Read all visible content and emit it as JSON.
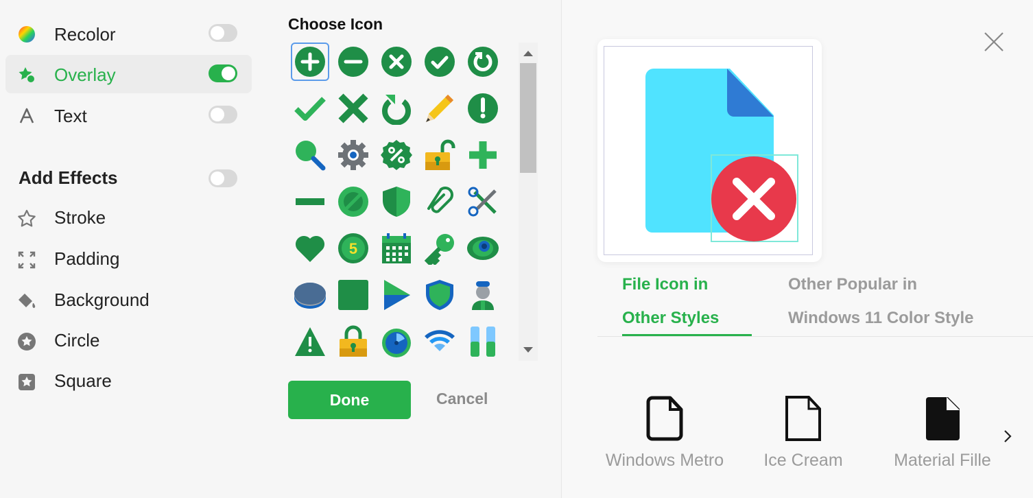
{
  "overlay_options": [
    {
      "label": "Recolor",
      "icon": "color-wheel-icon",
      "on": false
    },
    {
      "label": "Overlay",
      "icon": "overlay-star-icon",
      "on": true
    },
    {
      "label": "Text",
      "icon": "text-a-icon",
      "on": false
    }
  ],
  "effects": {
    "title": "Add Effects",
    "toggle_on": false,
    "items": [
      {
        "label": "Stroke",
        "icon": "star-outline-icon"
      },
      {
        "label": "Padding",
        "icon": "padding-arrows-icon"
      },
      {
        "label": "Background",
        "icon": "paint-bucket-icon"
      },
      {
        "label": "Circle",
        "icon": "circle-star-icon"
      },
      {
        "label": "Square",
        "icon": "square-star-icon"
      }
    ]
  },
  "chooser": {
    "title": "Choose Icon",
    "icons": [
      "add-circle-icon",
      "minus-circle-icon",
      "close-circle-icon",
      "check-circle-icon",
      "refresh-circle-icon",
      "checkmark-icon",
      "x-mark-icon",
      "rotate-arrow-icon",
      "pencil-icon",
      "exclamation-circle-icon",
      "magnifier-icon",
      "settings-gear-icon",
      "percent-badge-icon",
      "unlocked-padlock-icon",
      "plus-icon",
      "minus-bar-icon",
      "cancel-circle-icon",
      "shield-icon",
      "paperclip-icon",
      "scissors-icon",
      "heart-icon",
      "number-5-icon",
      "calendar-icon",
      "key-icon",
      "eye-icon",
      "disc-icon",
      "square-icon",
      "play-triangle-icon",
      "shield-check-icon",
      "user-icon",
      "warning-triangle-icon",
      "locked-padlock-icon",
      "stopwatch-icon",
      "wifi-icon",
      "pause-icon"
    ],
    "selected_index": 0,
    "done_label": "Done",
    "cancel_label": "Cancel"
  },
  "preview": {
    "base_icon": "file-icon",
    "overlay_icon": "close-circle-icon",
    "colors": {
      "file": "#50e3ff",
      "corner": "#2f7bd4",
      "overlay": "#e8394b",
      "accent": "#28b14c"
    }
  },
  "tabs": [
    {
      "line1": "File Icon in",
      "line2": "Other Styles",
      "active": true
    },
    {
      "line1": "Other Popular in",
      "line2": "Windows 11 Color Style",
      "active": false
    }
  ],
  "styles": [
    {
      "label": "Windows Metro",
      "icon": "file-rounded-outline-icon"
    },
    {
      "label": "Ice Cream",
      "icon": "file-outline-icon"
    },
    {
      "label": "Material Fille",
      "icon": "file-filled-icon"
    }
  ]
}
